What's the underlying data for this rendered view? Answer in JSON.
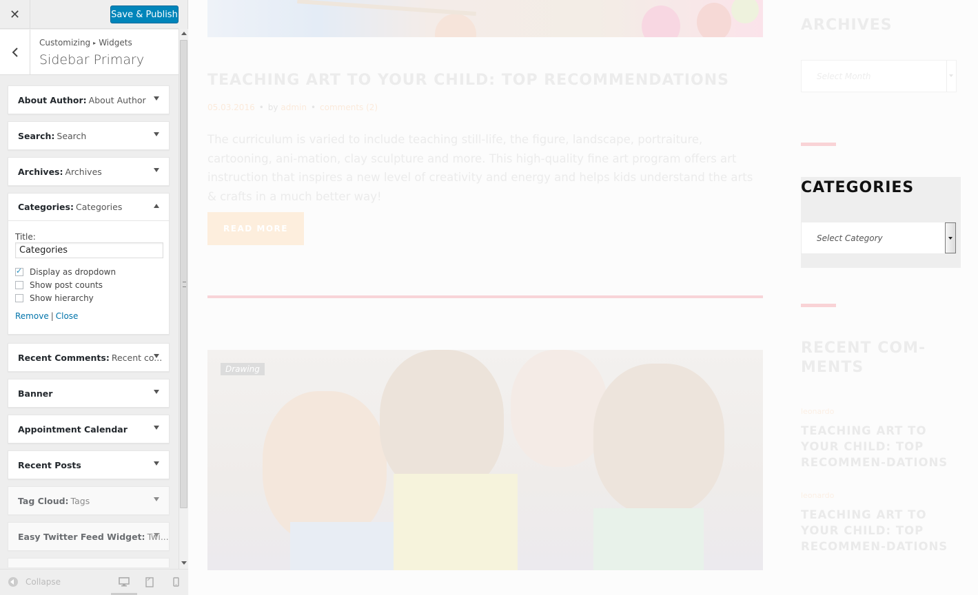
{
  "customizer": {
    "header": {
      "close_icon": "close-icon",
      "save_label": "Save & Publish",
      "save_color": "#0085ba"
    },
    "breadcrumb": {
      "root": "Customizing",
      "child": "Widgets"
    },
    "section_title": "Sidebar Primary",
    "widgets": [
      {
        "name": "About Author:",
        "subtitle": "About Author",
        "state": "collapsed"
      },
      {
        "name": "Search:",
        "subtitle": "Search",
        "state": "collapsed"
      },
      {
        "name": "Archives:",
        "subtitle": "Archives",
        "state": "collapsed"
      },
      {
        "name": "Categories:",
        "subtitle": "Categories",
        "state": "expanded"
      },
      {
        "name": "Recent Comments:",
        "subtitle": "Recent co...",
        "state": "collapsed"
      },
      {
        "name": "Banner",
        "subtitle": "",
        "state": "collapsed"
      },
      {
        "name": "Appointment Calendar",
        "subtitle": "",
        "state": "collapsed"
      },
      {
        "name": "Recent Posts",
        "subtitle": "",
        "state": "collapsed"
      },
      {
        "name": "Tag Cloud:",
        "subtitle": "Tags",
        "state": "inactive"
      },
      {
        "name": "Easy Twitter Feed Widget:",
        "subtitle": "Twi...",
        "state": "inactive"
      }
    ],
    "categories_form": {
      "title_label": "Title:",
      "title_value": "Categories",
      "options": [
        {
          "label": "Display as dropdown",
          "checked": true
        },
        {
          "label": "Show post counts",
          "checked": false
        },
        {
          "label": "Show hierarchy",
          "checked": false
        }
      ],
      "remove_label": "Remove",
      "separator": "|",
      "close_label": "Close"
    },
    "footer": {
      "collapse_label": "Collapse",
      "devices": [
        "desktop-icon",
        "tablet-icon",
        "mobile-icon"
      ]
    }
  },
  "preview": {
    "post": {
      "title": "TEACHING ART TO YOUR CHILD: TOP RECOMMENDATIONS",
      "date": "05.03.2016",
      "by": "by",
      "author": "admin",
      "comments": "comments (2)",
      "excerpt": "The curriculum is varied to include teaching still-life, the figure, landscape, portraiture, cartooning, ani-mation, clay sculpture and more. This high-quality fine art program offers art instruction that inspires a new level of creativity and energy and helps kids understand the arts & crafts in a much better way!",
      "read_more": "READ MORE"
    },
    "second_post": {
      "tag": "Drawing"
    },
    "sidebar": {
      "archives_title": "ARCHIVES",
      "archives_placeholder": "Select Month",
      "categories_title": "CATEGORIES",
      "categories_placeholder": "Select Category",
      "recent_comments_title": "RECENT COM-MENTS",
      "recent_comments": [
        {
          "author": "leonardo",
          "post": "TEACHING ART TO YOUR CHILD: TOP RECOMMEN-DATIONS"
        },
        {
          "author": "leonardo",
          "post": "TEACHING ART TO YOUR CHILD: TOP RECOMMEN-DATIONS"
        }
      ]
    }
  }
}
